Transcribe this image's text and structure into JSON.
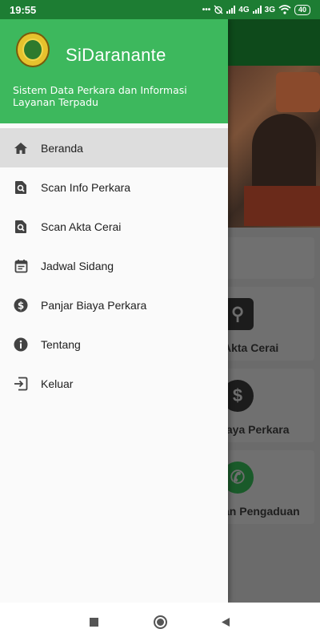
{
  "status_bar": {
    "time": "19:55",
    "network_1": "4G",
    "network_2": "3G",
    "battery": "40"
  },
  "drawer": {
    "app_title": "SiDaranante",
    "app_subtitle": "Sistem Data Perkara dan Informasi Layanan Terpadu",
    "menu": [
      {
        "label": "Beranda",
        "icon": "home-icon",
        "active": true
      },
      {
        "label": "Scan Info Perkara",
        "icon": "scan-search-icon",
        "active": false
      },
      {
        "label": "Scan Akta Cerai",
        "icon": "scan-search-icon",
        "active": false
      },
      {
        "label": "Jadwal Sidang",
        "icon": "calendar-icon",
        "active": false
      },
      {
        "label": "Panjar Biaya Perkara",
        "icon": "dollar-icon",
        "active": false
      },
      {
        "label": "Tentang",
        "icon": "info-icon",
        "active": false
      },
      {
        "label": "Keluar",
        "icon": "logout-icon",
        "active": false
      }
    ]
  },
  "background_screen": {
    "cards": [
      "Akta Cerai",
      "iaya Perkara",
      "an Pengaduan"
    ]
  },
  "colors": {
    "header_green": "#3db85d",
    "status_green": "#1d7d33",
    "active_item": "#dddddd"
  }
}
